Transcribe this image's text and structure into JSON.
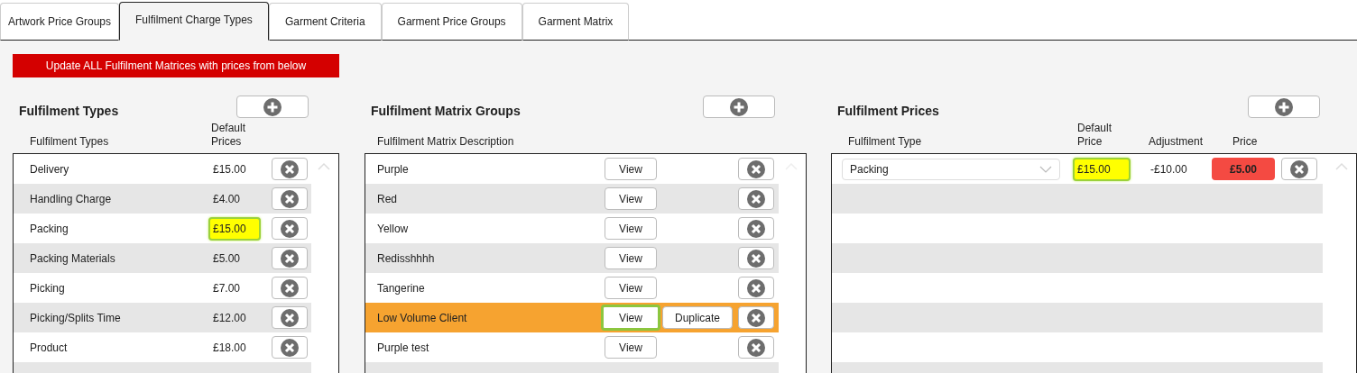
{
  "tabs": [
    {
      "label": "Artwork Price Groups",
      "selected": false
    },
    {
      "label": "Fulfilment Charge Types",
      "selected": true
    },
    {
      "label": "Garment Criteria",
      "selected": false
    },
    {
      "label": "Garment Price Groups",
      "selected": false
    },
    {
      "label": "Garment Matrix",
      "selected": false
    }
  ],
  "update_button": "Update ALL Fulfilment Matrices with prices from below",
  "fulfilment_types": {
    "title": "Fulfilment Types",
    "columns": [
      "Fulfilment Types",
      "Default Prices"
    ],
    "rows": [
      {
        "name": "Delivery",
        "price": "£15.00",
        "highlighted": false
      },
      {
        "name": "Handling Charge",
        "price": "£4.00",
        "highlighted": false
      },
      {
        "name": "Packing",
        "price": "£15.00",
        "highlighted": true
      },
      {
        "name": "Packing Materials",
        "price": "£5.00",
        "highlighted": false
      },
      {
        "name": "Picking",
        "price": "£7.00",
        "highlighted": false
      },
      {
        "name": "Picking/Splits Time",
        "price": "£12.00",
        "highlighted": false
      },
      {
        "name": "Product",
        "price": "£18.00",
        "highlighted": false
      }
    ]
  },
  "matrix_groups": {
    "title": "Fulfilment Matrix Groups",
    "columns": [
      "Fulfilment Matrix Description"
    ],
    "rows": [
      {
        "description": "Purple",
        "view": "View",
        "selected": false
      },
      {
        "description": "Red",
        "view": "View",
        "selected": false
      },
      {
        "description": "Yellow",
        "view": "View",
        "selected": false
      },
      {
        "description": "Redisshhhh",
        "view": "View",
        "selected": false
      },
      {
        "description": "Tangerine",
        "view": "View",
        "selected": false
      },
      {
        "description": "Low Volume Client",
        "view": "View",
        "duplicate": "Duplicate",
        "selected": true
      },
      {
        "description": "Purple test",
        "view": "View",
        "selected": false
      }
    ]
  },
  "fulfilment_prices": {
    "title": "Fulfilment Prices",
    "columns": [
      "Fulfilment Type",
      "Default Price",
      "Adjustment",
      "Price"
    ],
    "rows": [
      {
        "type": "Packing",
        "default_price": "£15.00",
        "adjustment": "-£10.00",
        "price": "£5.00",
        "highlighted": true
      }
    ]
  }
}
